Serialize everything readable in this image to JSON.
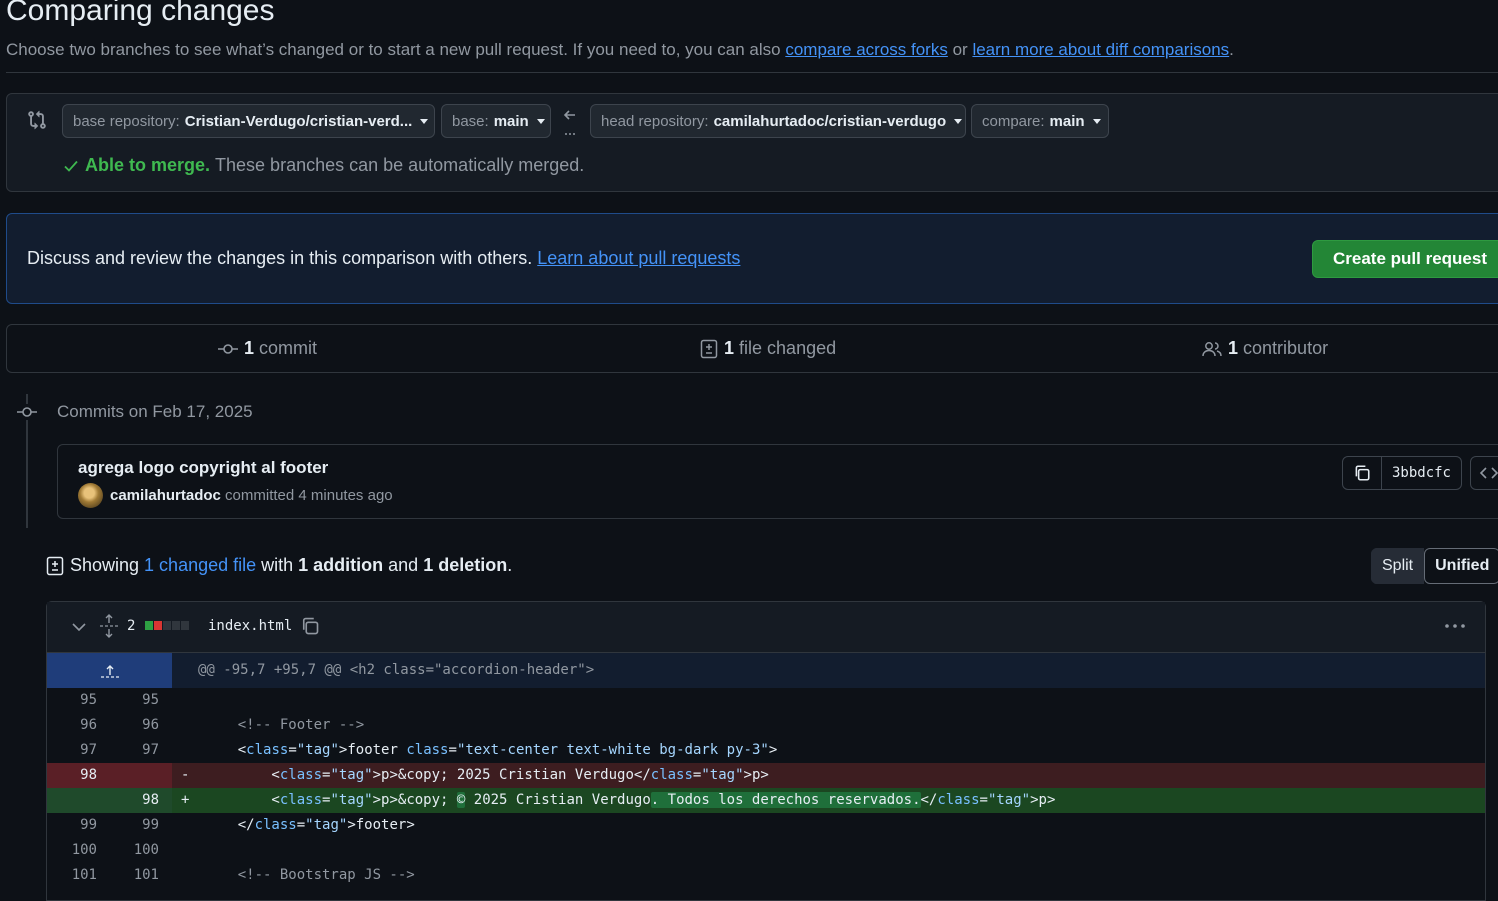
{
  "header": {
    "title": "Comparing changes",
    "subtitle_prefix": "Choose two branches to see what’s changed or to start a new pull request. If you need to, you can also",
    "link_forks": "compare across forks",
    "subtitle_or": "or",
    "link_learn": "learn more about diff comparisons",
    "subtitle_end": "."
  },
  "range": {
    "base_repo_key": "base repository:",
    "base_repo_value": "Cristian-Verdugo/cristian-verd...",
    "base_key": "base:",
    "base_value": "main",
    "head_repo_key": "head repository:",
    "head_repo_value": "camilahurtadoc/cristian-verdugo",
    "compare_key": "compare:",
    "compare_value": "main",
    "merge_ok": "Able to merge.",
    "merge_rest": "These branches can be automatically merged."
  },
  "discuss": {
    "text": "Discuss and review the changes in this comparison with others.",
    "link": "Learn about pull requests",
    "button": "Create pull request"
  },
  "stats": {
    "commits_num": "1",
    "commits_label": "commit",
    "files_num": "1",
    "files_label": "file changed",
    "contrib_num": "1",
    "contrib_label": "contributor"
  },
  "commits": {
    "group_label": "Commits on Feb 17, 2025",
    "message": "agrega logo copyright al footer",
    "author": "camilahurtadoc",
    "meta": "committed 4 minutes ago",
    "sha": "3bbdcfc"
  },
  "summary": {
    "showing": "Showing",
    "changed_files": "1 changed file",
    "with": "with",
    "additions": "1 addition",
    "and": "and",
    "deletions": "1 deletion",
    "end": ".",
    "split": "Split",
    "unified": "Unified"
  },
  "file": {
    "changes": "2",
    "name": "index.html",
    "hunk": "@@ -95,7 +95,7 @@ <h2 class=\"accordion-header\">",
    "colors": {
      "add": "#1b4721",
      "add_gutter": "#1f4a2b",
      "del": "#3d1d20",
      "del_gutter": "#5a1f26",
      "blue": "#1f3d7a"
    },
    "lines": [
      {
        "old": "95",
        "new": "95",
        "sign": "",
        "code": ""
      },
      {
        "old": "96",
        "new": "96",
        "sign": "",
        "code": "    <!-- Footer -->"
      },
      {
        "old": "97",
        "new": "97",
        "sign": "",
        "code": "    <footer class=\"text-center text-white bg-dark py-3\">"
      },
      {
        "old": "98",
        "new": "",
        "sign": "-",
        "code": "        <p>&copy; 2025 Cristian Verdugo</p>"
      },
      {
        "old": "",
        "new": "98",
        "sign": "+",
        "code_a": "        <p>&copy; ",
        "code_hl1": "©",
        "code_b": " 2025 Cristian Verdugo",
        "code_hl2": ". Todos los derechos reservados.",
        "code_c": "</p>"
      },
      {
        "old": "99",
        "new": "99",
        "sign": "",
        "code": "    </footer>"
      },
      {
        "old": "100",
        "new": "100",
        "sign": "",
        "code": ""
      },
      {
        "old": "101",
        "new": "101",
        "sign": "",
        "code": "    <!-- Bootstrap JS -->"
      }
    ]
  }
}
